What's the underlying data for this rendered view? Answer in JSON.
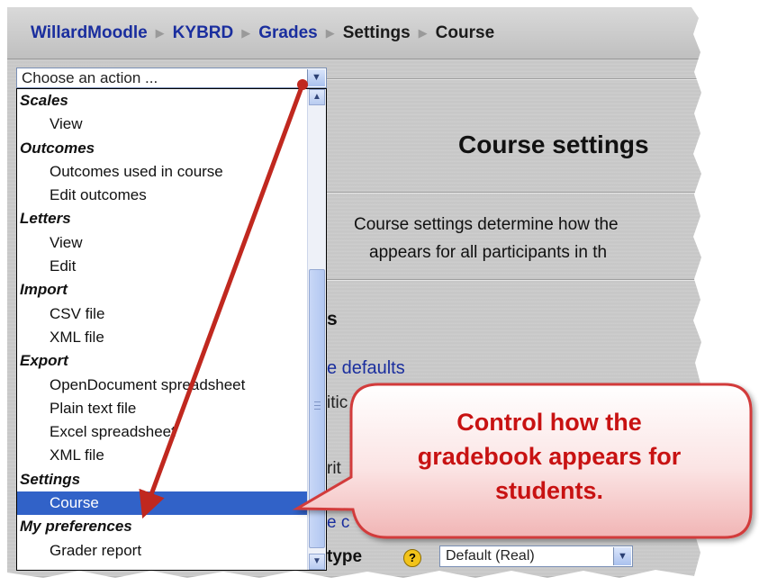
{
  "breadcrumb": {
    "items": [
      "WillardMoodle",
      "KYBRD",
      "Grades",
      "Settings",
      "Course"
    ]
  },
  "page": {
    "heading": "Course settings",
    "description_line1": "Course settings determine how the",
    "description_line2": "appears for all participants in th",
    "section_fragment": "s",
    "defaults_link": "e defaults",
    "fragment_itic": "itic",
    "fragment_rit": "rit",
    "fragment_c": "e c",
    "fragment_type": "type",
    "help_icon": "?",
    "display_type_value": "Default (Real)"
  },
  "action_select": {
    "value": "Choose an action ...",
    "arrow_icon": "chevron-down-icon"
  },
  "action_options": [
    {
      "label": "Scales",
      "type": "group"
    },
    {
      "label": "View",
      "type": "item"
    },
    {
      "label": "Outcomes",
      "type": "group"
    },
    {
      "label": "Outcomes used in course",
      "type": "item"
    },
    {
      "label": "Edit outcomes",
      "type": "item"
    },
    {
      "label": "Letters",
      "type": "group"
    },
    {
      "label": "View",
      "type": "item"
    },
    {
      "label": "Edit",
      "type": "item"
    },
    {
      "label": "Import",
      "type": "group"
    },
    {
      "label": "CSV file",
      "type": "item"
    },
    {
      "label": "XML file",
      "type": "item"
    },
    {
      "label": "Export",
      "type": "group"
    },
    {
      "label": "OpenDocument spreadsheet",
      "type": "item"
    },
    {
      "label": "Plain text file",
      "type": "item"
    },
    {
      "label": "Excel spreadsheet",
      "type": "item"
    },
    {
      "label": "XML file",
      "type": "item"
    },
    {
      "label": "Settings",
      "type": "group"
    },
    {
      "label": "Course",
      "type": "item",
      "selected": true
    },
    {
      "label": "My preferences",
      "type": "group"
    },
    {
      "label": "Grader report",
      "type": "item"
    }
  ],
  "callout": {
    "line1": "Control how the",
    "line2": "gradebook appears for",
    "line3": "students."
  },
  "colors": {
    "link": "#1a2e9e",
    "selection": "#3162c8",
    "arrow": "#c0281f",
    "callout_text": "#c81212"
  }
}
